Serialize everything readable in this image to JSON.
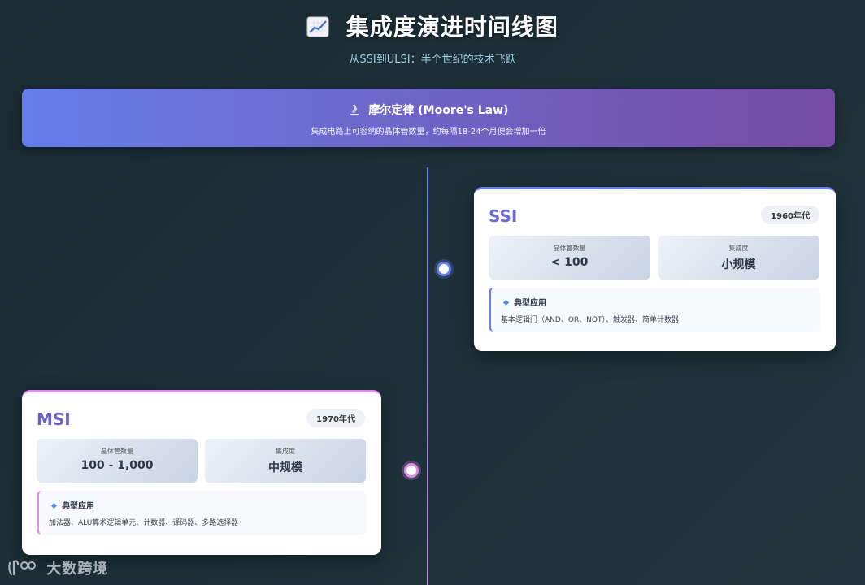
{
  "header": {
    "title": "集成度演进时间线图",
    "title_icon": "chart-increasing-icon",
    "subtitle": "从SSI到ULSI：半个世纪的技术飞跃"
  },
  "moore": {
    "icon": "microscope-icon",
    "title": "摩尔定律 (Moore's Law)",
    "description": "集成电路上可容纳的晶体管数量，约每隔18-24个月便会增加一倍"
  },
  "colors": {
    "accent": "#667eea",
    "accent_purple": "#764ba2",
    "msi_accent": "#e28ae8"
  },
  "cards": [
    {
      "name": "SSI",
      "era": "1960年代",
      "transistor_label": "晶体管数量",
      "transistor_value": "< 100",
      "integration_label": "集成度",
      "integration_value": "小规模",
      "app_title": "典型应用",
      "app_text": "基本逻辑门（AND、OR、NOT）、触发器、简单计数器"
    },
    {
      "name": "MSI",
      "era": "1970年代",
      "transistor_label": "晶体管数量",
      "transistor_value": "100 - 1,000",
      "integration_label": "集成度",
      "integration_value": "中规模",
      "app_title": "典型应用",
      "app_text": "加法器、ALU算术逻辑单元、计数器、译码器、多路选择器"
    }
  ],
  "watermark": {
    "text": "大数跨境"
  }
}
